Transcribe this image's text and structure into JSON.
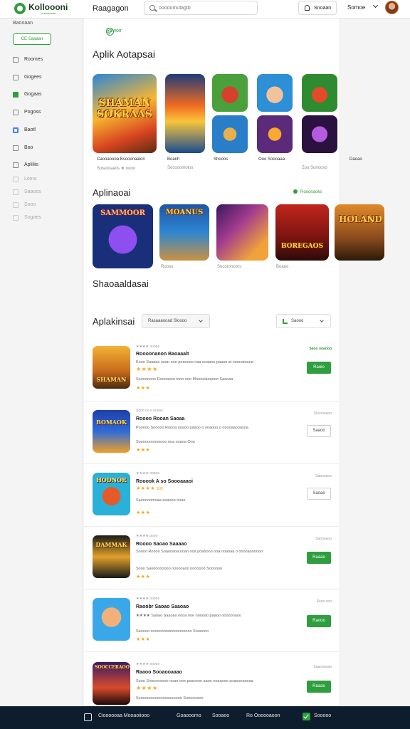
{
  "header": {
    "brand": "Kolloooni",
    "brand_sub": "maamaaaa",
    "nav_title": "Raagagon",
    "search_placeholder": "ooooomutagtb",
    "notif_label": "Snoaan",
    "user_name": "Somoe"
  },
  "sidebar": {
    "top_label": "Baooaan",
    "button_label": "CE Saaaan",
    "items": [
      {
        "label": "Roomes",
        "icon": "grid-icon"
      },
      {
        "label": "Gogees",
        "icon": "edit-icon"
      },
      {
        "label": "Gogaas",
        "icon": "green-app-icon"
      },
      {
        "label": "Pogoss",
        "icon": "people-icon"
      },
      {
        "label": "Baotl",
        "icon": "google-icon"
      },
      {
        "label": "Boo",
        "icon": "book-icon"
      },
      {
        "label": "Apliliis",
        "icon": "doc-icon"
      },
      {
        "label": "Lomo",
        "icon": "star-icon"
      },
      {
        "label": "Saaoos",
        "icon": "gift-icon"
      },
      {
        "label": "Sooo",
        "icon": "tag-icon"
      },
      {
        "label": "Sogaes",
        "icon": "menu-icon"
      }
    ]
  },
  "main": {
    "chip_label": "Rewoir",
    "section1_title": "Aplik Aotapsai",
    "featured": [
      {
        "art": "SHAMAN SOKRAAS",
        "caption": "Caooaoooa Bsooonaalon",
        "sub": "Sotaooaaos  ★  oooo"
      },
      {
        "art": "",
        "caption": "Boanh",
        "sub": "Socooomolos"
      },
      {
        "art": "",
        "caption": "Shooos",
        "sub": ""
      },
      {
        "art": "",
        "caption": "Ooo Soooaaa",
        "sub": "Zoo  Sonooso"
      },
      {
        "art": "",
        "caption": "Daoao",
        "sub": ""
      }
    ],
    "section2_title": "Aplinaoai",
    "section2_link": "Rooonaoks",
    "row2": [
      {
        "art": "SAMMOOR",
        "caption": ""
      },
      {
        "art": "MOANUS",
        "caption": "Rooos"
      },
      {
        "art": "",
        "caption": "Socoronoors"
      },
      {
        "art": "BOREGAOS",
        "caption": "Boaoo"
      },
      {
        "art": "HOLAND",
        "caption": ""
      }
    ],
    "section3_title": "Shaoaaldasai",
    "section4_title": "Aplakinsai",
    "sort_label": "Rasaaaooad  Sloooo",
    "filter_label": "Saooo"
  },
  "list": [
    {
      "meta": "★★★★  oooos",
      "title": "Roooonanon Baoaaalt",
      "desc1": "Kooo Saaaoa ooan ooe poaoooo naa ooaaoo paaoo at ooonatoona",
      "stars": "★★★★",
      "desc2": "Soooooooo Roooaooo toon ooo Mooooiaoaooo Saaoaa",
      "small": "★★★",
      "price": "Saoo ooaooo",
      "price_green": true,
      "button": "Raoio",
      "button_fill": true,
      "art": "SHAMAN"
    },
    {
      "meta": "Sooo oo o oooos",
      "title": "Roooo Rooan Saoaa",
      "desc1": "Pooooo Sooooo Roooa ooaoo paaoo o ooaooo o ooooaaooasoa",
      "stars": "★★★",
      "desc2": "Sooooooooooooo noa   ooaoa  Ooo",
      "small": "",
      "price": "Socoooaoo",
      "price_green": false,
      "button": "Saaoo",
      "button_fill": false,
      "art": "BOMAOK"
    },
    {
      "meta": "★★★★  oooos",
      "title": "Rooook A so Soooaaaoi",
      "desc1": "★★★★ oo",
      "stars": "★★★",
      "desc2": "Saooooomoaa aoaooo ooao",
      "small": "",
      "price": "Saaooaoo",
      "price_green": false,
      "button": "Saoao",
      "button_fill": false,
      "art": "HODNOR"
    },
    {
      "meta": "★★★★  oooo",
      "title": "Roooo Saoao Saaaao",
      "desc1": "Soooo Roooo Soaooaoa ooan ooa poaoooo ooa ooaoaa o ooooaoooooo",
      "stars": "★★★",
      "desc2": "Sooo Saooooooooo oooooaoo ooooooo   Soooooo",
      "small": "",
      "price": "Saoooaoo",
      "price_green": false,
      "button": "Raaao",
      "button_fill": true,
      "art": "DAMMAK"
    },
    {
      "meta": "★★★★  oooos",
      "title": "Raoobr Saoao Saaoao",
      "desc1": "★★★★ Saoao Saaoao oooa ooe ooooao paaoo ooooooaoo",
      "stars": "★★★",
      "desc2": "Saoooo ooooooooooooooooooo  Soooooo",
      "small": "",
      "price": "Saoo ooo",
      "price_green": false,
      "button": "Raooo",
      "button_fill": true,
      "art": ""
    },
    {
      "meta": "★★★★  oooos",
      "title": "Raaoo Sooaooaaao",
      "desc1": "Sooo Sooooooooo ooan ooe poaoooo aaoo ooaaooo aoaoooaooaa",
      "stars": "★★★★",
      "desc2": "Soooooooooooooooooooo  Soooooooo",
      "small": "",
      "price": "Saaooooao",
      "price_green": false,
      "button": "Raaao",
      "button_fill": true,
      "art": "SOOCCERAOO"
    }
  ],
  "bottom_bar": {
    "items": [
      "Cioooooaa  Mooaoiiooo",
      "Goaooomo",
      "Sooaoo",
      "Ro Oooooaoon",
      "Sooooo"
    ]
  },
  "colors": {
    "accent": "#2f9e3e",
    "bottom_bar": "#0d1d2d"
  }
}
